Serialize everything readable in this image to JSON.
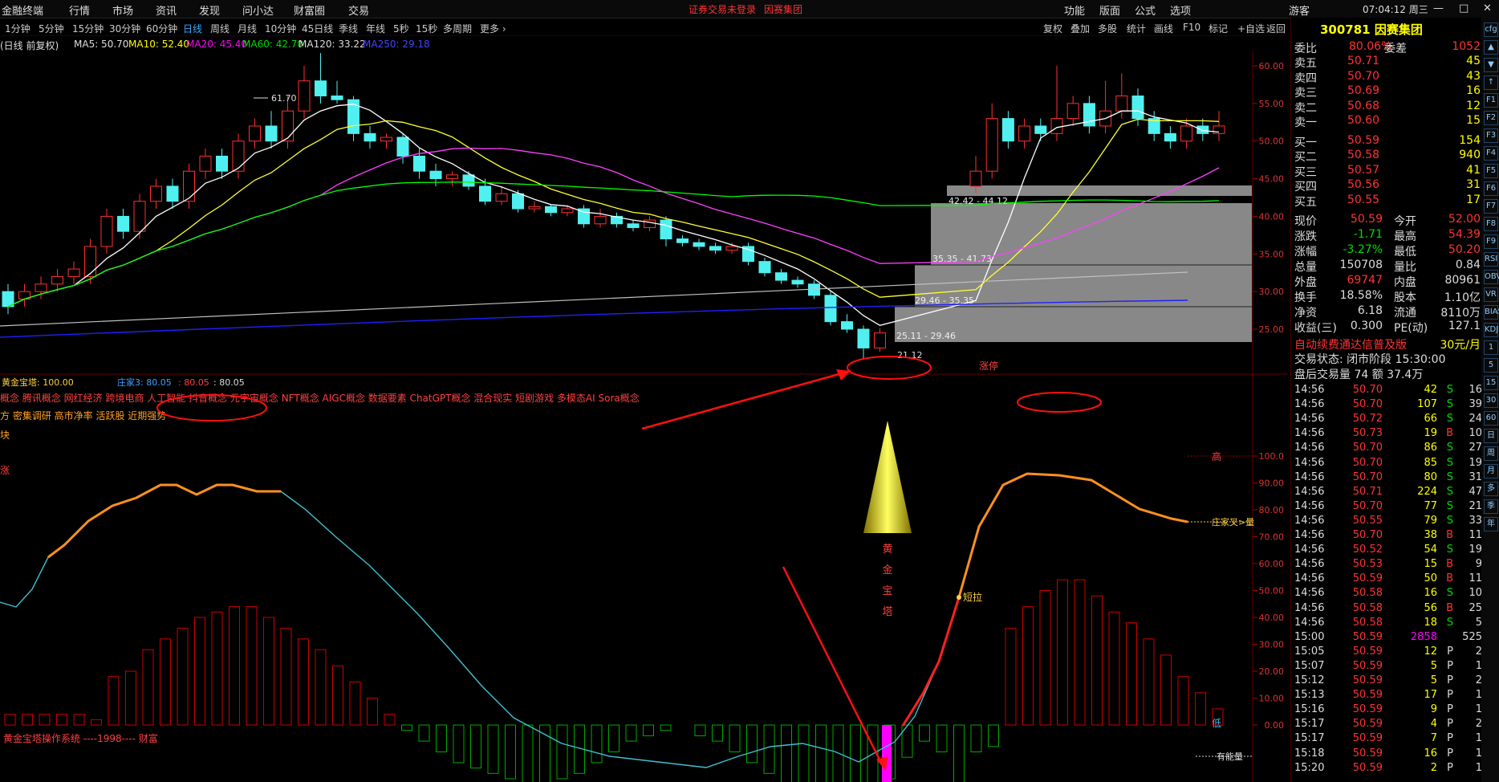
{
  "menubar": {
    "app_title": "金融终端",
    "items": [
      "行情",
      "市场",
      "资讯",
      "发现",
      "问小达",
      "财富圈",
      "交易"
    ],
    "notice": "证券交易未登录",
    "notice_stock": "因赛集团",
    "right_items": [
      "功能",
      "版面",
      "公式",
      "选项"
    ],
    "user": "游客",
    "time": "07:04:12 周三"
  },
  "periods": [
    "1分钟",
    "5分钟",
    "15分钟",
    "30分钟",
    "60分钟",
    "日线",
    "周线",
    "月线",
    "10分钟",
    "45日线",
    "季线",
    "年线",
    "5秒",
    "15秒",
    "多周期",
    "更多"
  ],
  "active_period": "日线",
  "tools": [
    "复权",
    "叠加",
    "多股",
    "统计",
    "画线",
    "F10",
    "标记",
    "+自选",
    "返回"
  ],
  "ma_info": {
    "prefix": "(日线 前复权)",
    "ma5": "MA5: 50.70",
    "ma10": "MA10: 52.40",
    "ma20": "MA20: 45.40",
    "ma60": "MA60: 42.70",
    "ma120": "MA120: 33.22",
    "ma250": "MA250: 29.18"
  },
  "colors": {
    "up": "#ff3030",
    "down": "#50f0f0",
    "ma5": "#ffffff",
    "ma10": "#ffff30",
    "ma20": "#ff40ff",
    "ma60": "#00ff00",
    "ma120": "#c0c0c0",
    "ma250": "#2020ff"
  },
  "price_axis": [
    "60.00",
    "55.00",
    "50.00",
    "45.00",
    "40.00",
    "35.00",
    "30.00",
    "25.00"
  ],
  "ind_axis": [
    "100.0",
    "90.00",
    "80.00",
    "70.00",
    "60.00",
    "50.00",
    "40.00",
    "30.00",
    "20.00",
    "10.00",
    "0.00"
  ],
  "annotations": {
    "high_label": "61.70",
    "low_label": "21.12",
    "zt_label": "涨停",
    "range1": "42.42 - 44.12",
    "range2": "35.35 - 41.73",
    "range3": "29.46 - 35.35",
    "range4": "25.11 - 29.46"
  },
  "indicator": {
    "title": "黄金宝塔",
    "v1": ": 100.00",
    "zhuang_label": "庄家3: 80.05",
    "v2": ": 80.05",
    "v3": ": 80.05",
    "concepts": "概念 腾讯概念 网红经济 跨境电商 人工智能 抖音概念 元宇宙概念 NFT概念 AIGC概念 数据要素 ChatGPT概念 混合现实 短剧游戏 多模态AI Sora概念",
    "concepts2": "方 密集调研 高市净率 活跃股 近期强势",
    "block_label": "块",
    "sz_label": "涨",
    "tower_label": [
      "黄",
      "金",
      "宝",
      "塔"
    ],
    "duanla": "短拉",
    "high_tag": "高",
    "low_tag": "低",
    "zhuang_cross": "庄家叉>量",
    "energy": "有能量",
    "footer": "黄金宝塔操作系统   ----1998---- 财富"
  },
  "quote": {
    "code_name": "300781 因赛集团",
    "weibi_label": "委比",
    "weibi": "80.06%",
    "weicha_label": "委差",
    "weicha": "1052",
    "asks": [
      [
        "卖五",
        "50.71",
        "45"
      ],
      [
        "卖四",
        "50.70",
        "43"
      ],
      [
        "卖三",
        "50.69",
        "16"
      ],
      [
        "卖二",
        "50.68",
        "12"
      ],
      [
        "卖一",
        "50.60",
        "15"
      ]
    ],
    "bids": [
      [
        "买一",
        "50.59",
        "154"
      ],
      [
        "买二",
        "50.58",
        "940"
      ],
      [
        "买三",
        "50.57",
        "41"
      ],
      [
        "买四",
        "50.56",
        "31"
      ],
      [
        "买五",
        "50.55",
        "17"
      ]
    ],
    "stats": [
      [
        "现价",
        "50.59",
        "今开",
        "52.00"
      ],
      [
        "涨跌",
        "-1.71",
        "最高",
        "54.39"
      ],
      [
        "涨幅",
        "-3.27%",
        "最低",
        "50.20"
      ],
      [
        "总量",
        "150708",
        "量比",
        "0.84"
      ],
      [
        "外盘",
        "69747",
        "内盘",
        "80961"
      ],
      [
        "换手",
        "18.58%",
        "股本",
        "1.10亿"
      ],
      [
        "净资",
        "6.18",
        "流通",
        "8110万"
      ],
      [
        "收益(三)",
        "0.300",
        "PE(动)",
        "127.1"
      ]
    ],
    "ad": "自动续费通达信普及版",
    "ad_price": "30元/月",
    "trade_state": "交易状态: 闭市阶段 15:30:00",
    "after": "盘后交易量 74 额 37.4万"
  },
  "ticks": [
    [
      "14:56",
      "50.70",
      "42",
      "S",
      "16"
    ],
    [
      "14:56",
      "50.70",
      "107",
      "S",
      "39"
    ],
    [
      "14:56",
      "50.72",
      "66",
      "S",
      "24"
    ],
    [
      "14:56",
      "50.73",
      "19",
      "B",
      "10"
    ],
    [
      "14:56",
      "50.70",
      "86",
      "S",
      "27"
    ],
    [
      "14:56",
      "50.70",
      "85",
      "S",
      "19"
    ],
    [
      "14:56",
      "50.70",
      "80",
      "S",
      "31"
    ],
    [
      "14:56",
      "50.71",
      "224",
      "S",
      "47"
    ],
    [
      "14:56",
      "50.70",
      "77",
      "S",
      "21"
    ],
    [
      "14:56",
      "50.55",
      "79",
      "S",
      "33"
    ],
    [
      "14:56",
      "50.70",
      "38",
      "B",
      "11"
    ],
    [
      "14:56",
      "50.52",
      "54",
      "S",
      "19"
    ],
    [
      "14:56",
      "50.53",
      "15",
      "B",
      "9"
    ],
    [
      "14:56",
      "50.59",
      "50",
      "B",
      "11"
    ],
    [
      "14:56",
      "50.58",
      "16",
      "S",
      "10"
    ],
    [
      "14:56",
      "50.58",
      "56",
      "B",
      "25"
    ],
    [
      "14:56",
      "50.58",
      "18",
      "S",
      "5"
    ],
    [
      "15:00",
      "50.59",
      "2858",
      "",
      "525"
    ],
    [
      "15:05",
      "50.59",
      "12",
      "P",
      "2"
    ],
    [
      "15:07",
      "50.59",
      "5",
      "P",
      "1"
    ],
    [
      "15:12",
      "50.59",
      "5",
      "P",
      "2"
    ],
    [
      "15:13",
      "50.59",
      "17",
      "P",
      "1"
    ],
    [
      "15:16",
      "50.59",
      "9",
      "P",
      "1"
    ],
    [
      "15:17",
      "50.59",
      "4",
      "P",
      "2"
    ],
    [
      "15:17",
      "50.59",
      "7",
      "P",
      "1"
    ],
    [
      "15:18",
      "50.59",
      "16",
      "P",
      "1"
    ],
    [
      "15:20",
      "50.59",
      "2",
      "P",
      "1"
    ]
  ],
  "sidebar_icons": [
    "cfg",
    "▲",
    "▼",
    "↑",
    "F1",
    "F2",
    "F3",
    "F4",
    "F5",
    "F6",
    "F7",
    "F8",
    "F9",
    "RSI",
    "OBV",
    "VR",
    "BIAS",
    "KDJ",
    "1",
    "5",
    "15",
    "30",
    "60",
    "日",
    "周",
    "月",
    "多",
    "季",
    "年"
  ],
  "candles": [
    [
      30,
      28,
      27,
      31
    ],
    [
      29,
      30,
      28,
      31
    ],
    [
      30,
      31,
      29,
      32
    ],
    [
      31,
      32,
      30,
      33
    ],
    [
      32,
      33,
      31,
      34
    ],
    [
      32,
      36,
      31,
      37
    ],
    [
      36,
      40,
      35,
      41
    ],
    [
      40,
      38,
      37,
      41
    ],
    [
      38,
      42,
      37,
      43
    ],
    [
      42,
      44,
      41,
      45
    ],
    [
      44,
      42,
      41,
      45
    ],
    [
      42,
      46,
      41,
      47
    ],
    [
      46,
      48,
      45,
      49
    ],
    [
      48,
      46,
      45,
      49
    ],
    [
      46,
      50,
      45,
      51
    ],
    [
      50,
      52,
      49,
      53
    ],
    [
      52,
      50,
      49,
      54
    ],
    [
      50,
      54,
      49,
      56
    ],
    [
      54,
      58,
      53,
      60
    ],
    [
      58,
      56,
      55,
      61.7
    ],
    [
      56,
      55.5,
      55,
      58
    ],
    [
      55.5,
      51,
      50,
      56
    ],
    [
      51,
      50,
      49,
      52
    ],
    [
      50,
      50.5,
      49,
      51
    ],
    [
      50.5,
      48,
      47,
      51
    ],
    [
      48,
      46,
      45,
      49
    ],
    [
      46,
      45,
      44,
      47
    ],
    [
      45,
      45.5,
      44,
      46
    ],
    [
      45.5,
      44,
      43.5,
      46
    ],
    [
      44,
      42,
      41.5,
      45
    ],
    [
      42,
      43,
      41.5,
      44
    ],
    [
      43,
      41,
      40.5,
      43.5
    ],
    [
      41,
      41.3,
      40.5,
      42
    ],
    [
      41.3,
      40.5,
      40,
      41.5
    ],
    [
      40.5,
      41,
      40,
      41.5
    ],
    [
      41,
      39,
      38.5,
      41.5
    ],
    [
      39,
      40,
      38.5,
      41
    ],
    [
      40,
      39,
      38.5,
      40.5
    ],
    [
      39,
      38.5,
      38,
      39.5
    ],
    [
      38.5,
      39.5,
      38,
      40
    ],
    [
      39.5,
      37,
      36,
      40
    ],
    [
      37,
      36.5,
      36,
      37.5
    ],
    [
      36.5,
      36,
      35.5,
      37
    ],
    [
      36,
      35.5,
      35,
      36.5
    ],
    [
      35.5,
      36,
      35,
      36.5
    ],
    [
      36,
      34,
      33.5,
      36.5
    ],
    [
      34,
      32.5,
      32,
      34.5
    ],
    [
      32.5,
      31.5,
      31,
      33
    ],
    [
      31.5,
      31,
      30.5,
      32
    ],
    [
      31,
      29.5,
      29,
      31.5
    ],
    [
      29.5,
      26,
      25.5,
      30
    ],
    [
      26,
      25,
      24.5,
      27
    ],
    [
      25,
      22.5,
      21.12,
      25.5
    ],
    [
      22.5,
      24.5,
      22,
      25.11
    ],
    [
      44,
      46,
      43,
      48
    ],
    [
      46,
      53,
      45,
      55
    ],
    [
      53,
      50,
      49,
      54
    ],
    [
      50,
      52,
      49,
      53
    ],
    [
      52,
      51,
      50,
      53
    ],
    [
      51,
      53,
      50,
      60
    ],
    [
      53,
      55,
      52,
      56
    ],
    [
      55,
      52,
      51,
      56
    ],
    [
      52,
      54,
      51,
      58
    ],
    [
      54,
      56,
      53,
      59
    ],
    [
      56,
      53,
      52,
      57
    ],
    [
      53,
      51,
      50,
      54
    ],
    [
      51,
      50,
      49,
      52
    ],
    [
      50,
      52,
      49,
      53
    ],
    [
      52,
      51,
      50,
      53
    ],
    [
      51,
      52,
      50,
      54
    ]
  ]
}
